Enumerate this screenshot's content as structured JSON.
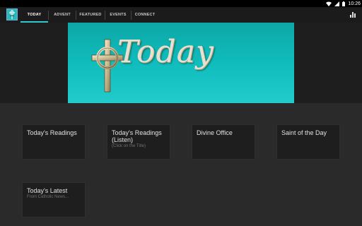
{
  "status": {
    "time": "10:26"
  },
  "tabs": [
    {
      "label": "TODAY",
      "active": true
    },
    {
      "label": "ADVENT",
      "active": false
    },
    {
      "label": "FEATURED",
      "active": false
    },
    {
      "label": "EVENTS",
      "active": false
    },
    {
      "label": "CONNECT",
      "active": false
    }
  ],
  "banner": {
    "text": "Today"
  },
  "cards": [
    {
      "title": "Today's Readings",
      "subtitle": ""
    },
    {
      "title": "Today's Readings (Listen)",
      "subtitle": "(Click on the Title)"
    },
    {
      "title": "Divine Office",
      "subtitle": ""
    },
    {
      "title": "Saint of the Day",
      "subtitle": ""
    },
    {
      "title": "Today's Latest",
      "subtitle": "From Catholic News..."
    }
  ],
  "colors": {
    "accent": "#33c7d0",
    "banner": "#10bcbc",
    "background": "#2a2a2a",
    "card": "#1e1e1e"
  }
}
